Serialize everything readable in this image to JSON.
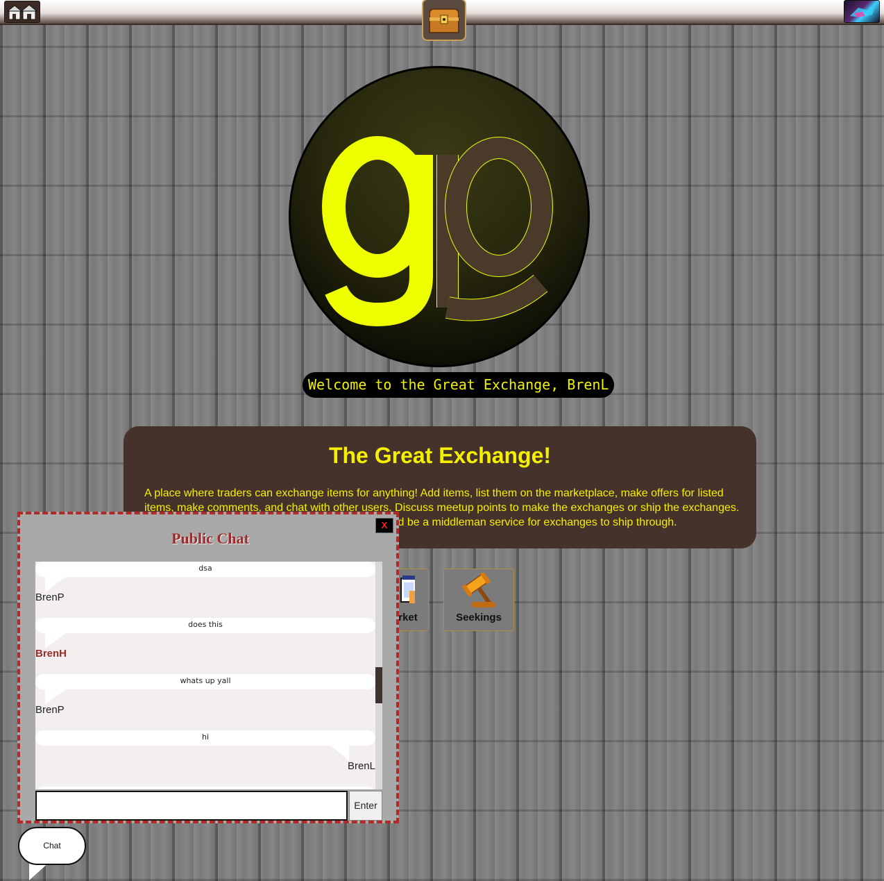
{
  "topbar": {
    "home_icon": "houses-icon",
    "center_icon": "treasure-chest-icon",
    "profile_icon": "profile-avatar-icon"
  },
  "logo": {
    "letters": "gp",
    "primary_color": "#eeff00",
    "secondary_color": "#4a3a2a"
  },
  "welcome_text": "Welcome to the Great Exchange, BrenL",
  "info": {
    "title": "The Great Exchange!",
    "line1": "A place where traders can exchange items for anything! Add items, list them on the marketplace, make offers for listed",
    "line2": "items, make comments, and chat with other users. Discuss meetup points to make the exchanges or ship the exchanges.",
    "line3": "ld be a middleman service for exchanges to ship through."
  },
  "nav": {
    "market_label": "rket",
    "market_icon": "market-stall-icon",
    "seekings_label": "Seekings",
    "seekings_icon": "gavel-icon"
  },
  "chat": {
    "title": "Public Chat",
    "close_label": "X",
    "messages": [
      {
        "text": "dsa",
        "sender": "BrenP",
        "side": "left",
        "admin": false
      },
      {
        "text": "does this",
        "sender": "BrenH",
        "side": "left",
        "admin": true
      },
      {
        "text": "whats up yall",
        "sender": "BrenP",
        "side": "left",
        "admin": false
      },
      {
        "text": "hi",
        "sender": "BrenL",
        "side": "right",
        "admin": false
      }
    ],
    "input_value": "",
    "enter_label": "Enter",
    "toggle_label": "Chat"
  },
  "colors": {
    "accent_yellow": "#f5f000",
    "panel_brown": "#45322b",
    "chat_border": "#b02a2a",
    "admin_name": "#9c2a2a"
  }
}
